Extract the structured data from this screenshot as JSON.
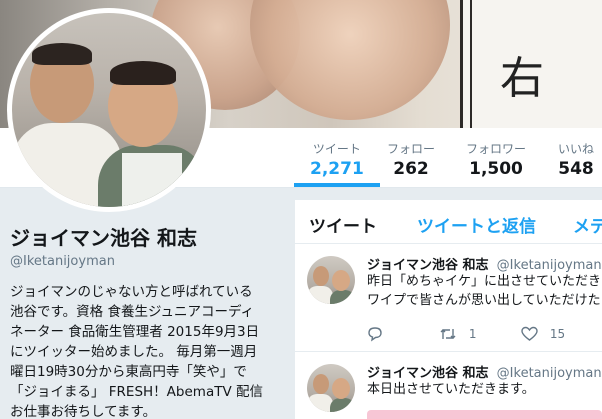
{
  "banner": {
    "board_char": "右"
  },
  "nav": {
    "stats": [
      {
        "label": "ツイート",
        "value": "2,271",
        "active": true
      },
      {
        "label": "フォロー",
        "value": "262"
      },
      {
        "label": "フォロワー",
        "value": "1,500"
      },
      {
        "label": "いいね",
        "value": "548"
      }
    ]
  },
  "profile": {
    "name": "ジョイマン池谷 和志",
    "handle": "@Iketanijoyman",
    "bio": [
      "ジョイマンのじゃない方と呼ばれている",
      "池谷です。資格 食養生ジュニアコーディ",
      "ネーター 食品衛生管理者 2015年9月3日",
      "にツイッター始めました。 毎月第一週月",
      "曜日19時30分から東高円寺「笑や」で",
      "「ジョイまる」 FRESH！AbemaTV 配信",
      "お仕事お待ちしてます。"
    ]
  },
  "timeline": {
    "tabs": [
      "ツイート",
      "ツイートと返信",
      "メディア"
    ],
    "tweets": [
      {
        "name": "ジョイマン池谷 和志",
        "handle": "@Iketanijoyman",
        "lines": [
          "昨日「めちゃイケ」に出させていただきました。",
          "ワイプで皆さんが思い出していただけたら"
        ],
        "retweets": "1",
        "likes": "15"
      },
      {
        "name": "ジョイマン池谷 和志",
        "handle": "@Iketanijoyman",
        "lines": [
          "本日出させていただきます。"
        ]
      }
    ]
  },
  "colors": {
    "accent": "#1da1f2",
    "text": "#14171a",
    "muted": "#657786"
  },
  "icons": [
    "reply-icon",
    "retweet-icon",
    "like-icon"
  ]
}
